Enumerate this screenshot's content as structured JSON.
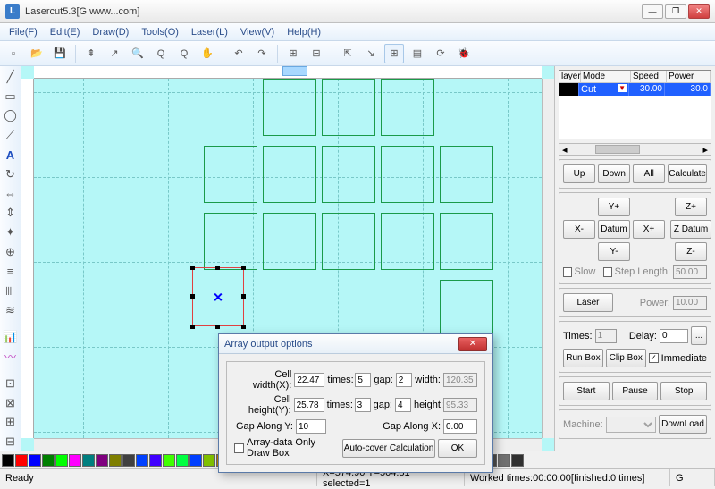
{
  "window": {
    "title": "Lasercut5.3[G www...com]"
  },
  "menu": {
    "file": "File(F)",
    "edit": "Edit(E)",
    "draw": "Draw(D)",
    "tools": "Tools(O)",
    "laser": "Laser(L)",
    "view": "View(V)",
    "help": "Help(H)"
  },
  "layer_table": {
    "hdr_layer": "layer",
    "hdr_mode": "Mode",
    "hdr_speed": "Speed",
    "hdr_power": "Power",
    "row_mode": "Cut",
    "row_speed": "30.00",
    "row_power": "30.0"
  },
  "right": {
    "up": "Up",
    "down": "Down",
    "all": "All",
    "calculate": "Calculate",
    "yplus": "Y+",
    "zplus": "Z+",
    "xminus": "X-",
    "datum": "Datum",
    "xplus": "X+",
    "zdatum": "Z Datum",
    "yminus": "Y-",
    "zminus": "Z-",
    "slow": "Slow",
    "step": "Step",
    "length_label": "Length:",
    "length_val": "50.00",
    "laser": "Laser",
    "power_label": "Power:",
    "power_val": "10.00",
    "times_label": "Times:",
    "times_val": "1",
    "delay_label": "Delay:",
    "delay_val": "0",
    "ellipsis": "...",
    "runbox": "Run Box",
    "clipbox": "Clip Box",
    "immediate": "Immediate",
    "start": "Start",
    "pause": "Pause",
    "stop": "Stop",
    "machine_label": "Machine:",
    "download": "DownLoad"
  },
  "dialog": {
    "title": "Array output options",
    "cell_w_label": "Cell width(X):",
    "cell_w": "22.47",
    "cell_h_label": "Cell height(Y):",
    "cell_h": "25.78",
    "times_label": "times:",
    "times_x": "5",
    "times_y": "3",
    "gap_label": "gap:",
    "gap_x": "2",
    "gap_y": "4",
    "width_label": "width:",
    "width_val": "120.35",
    "height_label": "height:",
    "height_val": "95.33",
    "gap_along_y_label": "Gap Along Y:",
    "gap_along_y": "10",
    "gap_along_x_label": "Gap Along X:",
    "gap_along_x": "0.00",
    "arraydata_label": "Array-data Only Draw Box",
    "autocover": "Auto-cover Calculation",
    "ok": "OK"
  },
  "status": {
    "ready": "Ready",
    "coords": "X=574.90 Y=504.81 selected=1",
    "worked": "Worked times:00:00:00[finished:0 times]",
    "g": "G"
  },
  "palette_colors": [
    "#000000",
    "#ff0000",
    "#0000ff",
    "#007f00",
    "#00ff00",
    "#ff00ff",
    "#007f7f",
    "#7f007f",
    "#7f7f00",
    "#404040",
    "#0040ff",
    "#4000ff",
    "#40ff00",
    "#00ff40",
    "#003fff",
    "#7fbf00",
    "#bf7f00",
    "#007fbf",
    "#5f3f9f",
    "#9f3f5f",
    "#3f9f5f",
    "#9f5f3f",
    "#5f9f3f",
    "#3f5f9f",
    "#9f9f3f",
    "#3f9f9f",
    "#9f3f9f",
    "#606060",
    "#808080",
    "#a0a0a0",
    "#404060",
    "#406040",
    "#604040",
    "#604060",
    "#406060",
    "#606040",
    "#505050",
    "#707070",
    "#303030"
  ]
}
